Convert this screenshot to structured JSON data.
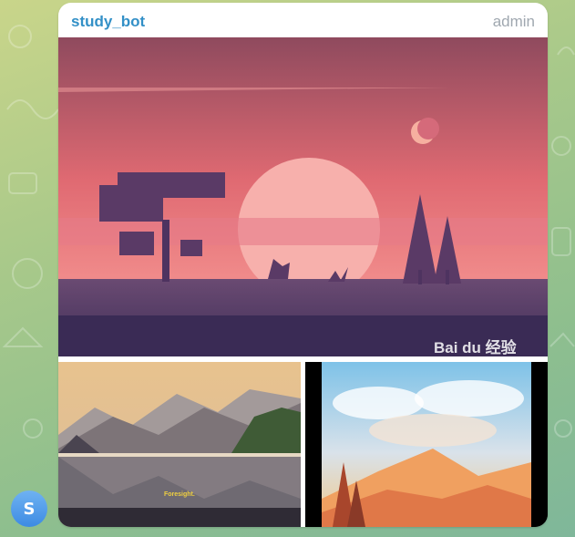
{
  "message": {
    "sender_name": "study_bot",
    "sender_role": "admin"
  },
  "photos": [
    {
      "icon": "landscape-sunset-image",
      "watermark": "Bai du 经验"
    },
    {
      "icon": "landscape-mountain-lake-image",
      "caption": "Foresight."
    },
    {
      "icon": "landscape-painted-sky-image"
    }
  ],
  "avatar": {
    "letter": "S",
    "color": "#4a97ea"
  },
  "colors": {
    "sender": "#3390c7",
    "role": "#a0a8b0"
  }
}
